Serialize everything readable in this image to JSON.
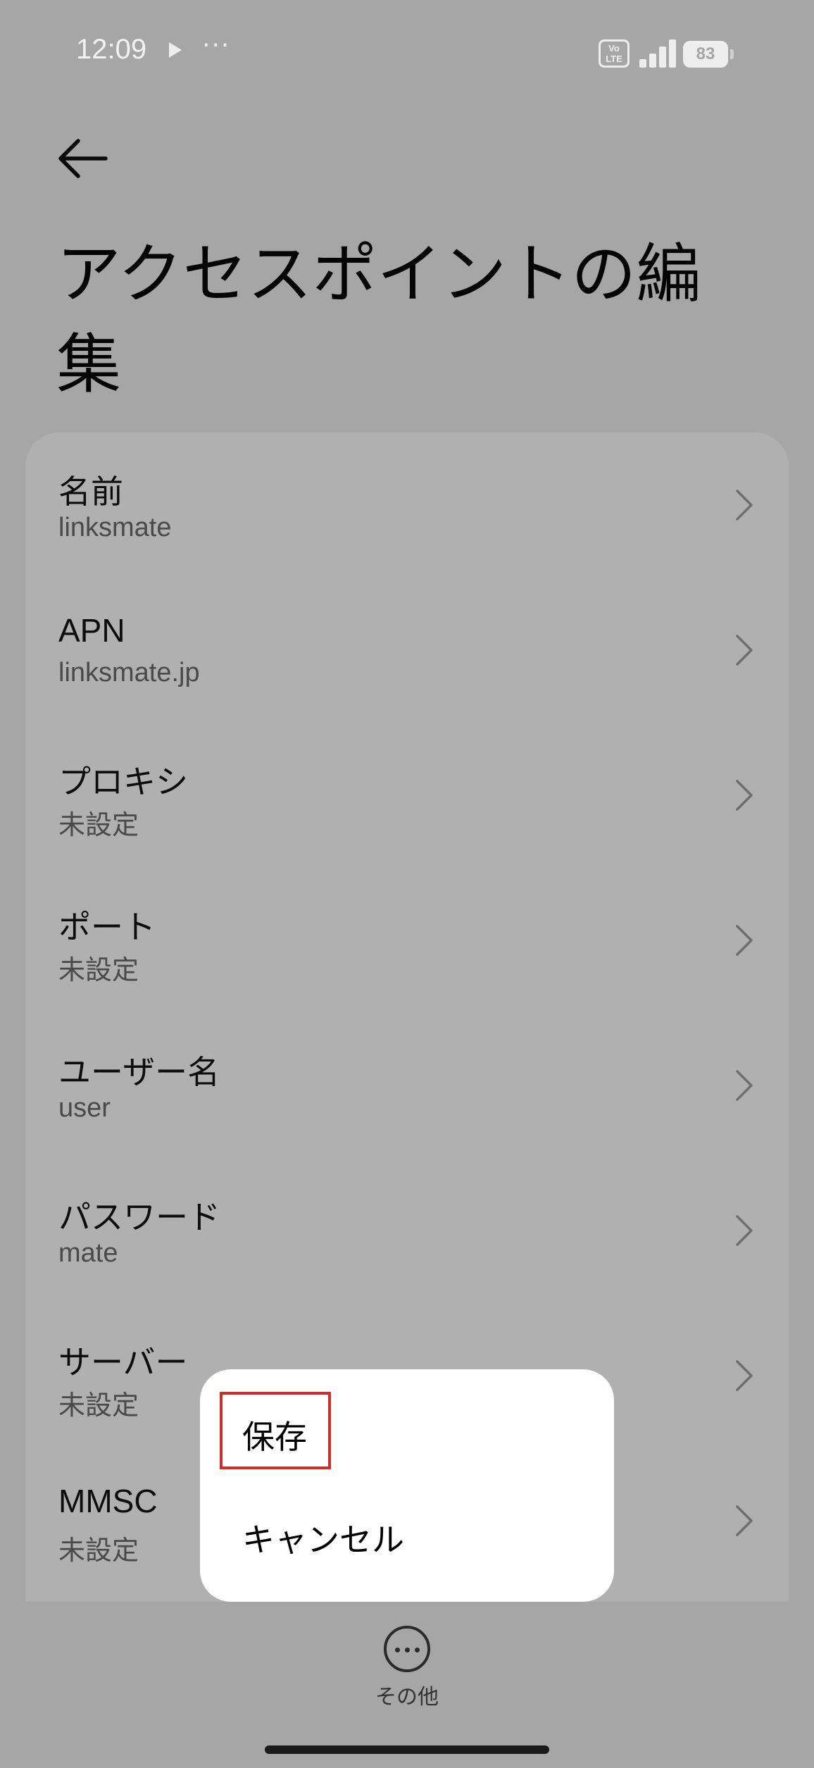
{
  "status_bar": {
    "time": "12:09",
    "volte": "Vo\nLTE",
    "battery": "83"
  },
  "header": {
    "title": "アクセスポイントの編集"
  },
  "rows": [
    {
      "label": "名前",
      "value": "linksmate"
    },
    {
      "label": "APN",
      "value": "linksmate.jp"
    },
    {
      "label": "プロキシ",
      "value": "未設定"
    },
    {
      "label": "ポート",
      "value": "未設定"
    },
    {
      "label": "ユーザー名",
      "value": "user"
    },
    {
      "label": "パスワード",
      "value": "mate"
    },
    {
      "label": "サーバー",
      "value": "未設定"
    },
    {
      "label": "MMSC",
      "value": "未設定"
    }
  ],
  "menu": {
    "save": "保存",
    "cancel": "キャンセル"
  },
  "bottom": {
    "more_label": "その他"
  }
}
